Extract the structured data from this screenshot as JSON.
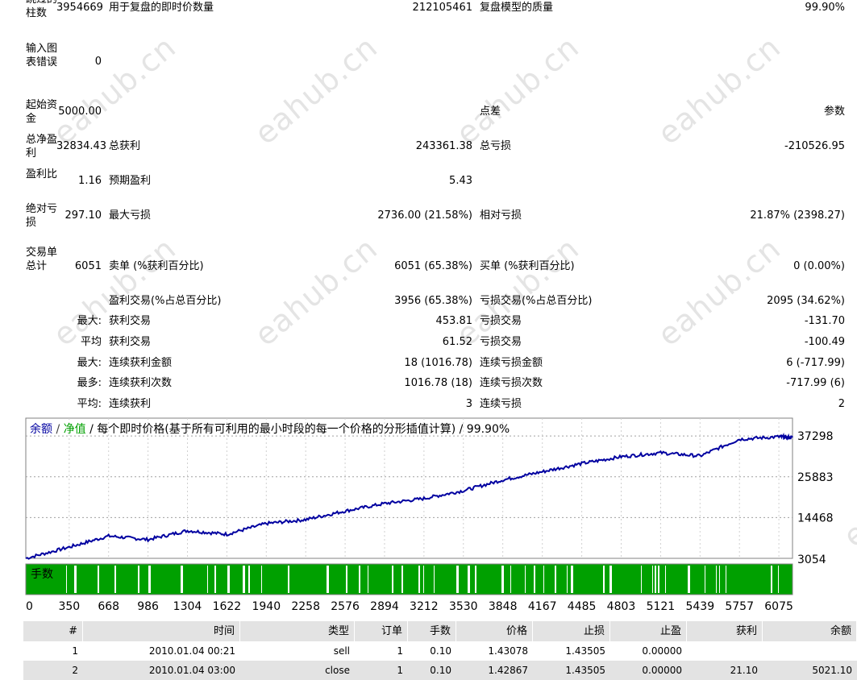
{
  "stats": {
    "r0": {
      "label": "跳过的柱数",
      "value": "3954669",
      "c2": "用于复盘的即时价数量",
      "v2": "212105461",
      "c3": "复盘模型的质量",
      "v3": "99.90%"
    },
    "r1": {
      "label": "输入图表错误",
      "value": "0"
    },
    "r2": {
      "label": "起始资金",
      "value": "5000.00",
      "c3": "点差",
      "v3": "参数"
    },
    "r3": {
      "label": "总净盈利",
      "value": "32834.43",
      "c2": "总获利",
      "v2": "243361.38",
      "c3": "总亏损",
      "v3": "-210526.95"
    },
    "r4": {
      "label": "盈利比",
      "value": "1.16",
      "c2": "预期盈利",
      "v2": "5.43"
    },
    "r5": {
      "label": "绝对亏损",
      "value": "297.10",
      "c2": "最大亏损",
      "v2": "2736.00 (21.58%)",
      "c3": "相对亏损",
      "v3": "21.87% (2398.27)"
    },
    "r6": {
      "label": "交易单总计",
      "value": "6051",
      "c2": "卖单 (%获利百分比)",
      "v2": "6051 (65.38%)",
      "c3": "买单 (%获利百分比)",
      "v3": "0 (0.00%)"
    },
    "r7": {
      "c2": "盈利交易(%占总百分比)",
      "v2": "3956 (65.38%)",
      "c3": "亏损交易(%占总百分比)",
      "v3": "2095 (34.62%)"
    },
    "r8": {
      "pre": "最大:",
      "c2": "获利交易",
      "v2": "453.81",
      "c3": "亏损交易",
      "v3": "-131.70"
    },
    "r9": {
      "pre": "平均",
      "c2": "获利交易",
      "v2": "61.52",
      "c3": "亏损交易",
      "v3": "-100.49"
    },
    "r10": {
      "pre": "最大:",
      "c2": "连续获利金额",
      "v2": "18 (1016.78)",
      "c3": "连续亏损金额",
      "v3": "6 (-717.99)"
    },
    "r11": {
      "pre": "最多:",
      "c2": "连续获利次数",
      "v2": "1016.78 (18)",
      "c3": "连续亏损次数",
      "v3": "-717.99 (6)"
    },
    "r12": {
      "pre": "平均:",
      "c2": "连续获利",
      "v2": "3",
      "c3": "连续亏损",
      "v3": "2"
    }
  },
  "watermark": "eahub.cn",
  "chart": {
    "legend_balance": "余额",
    "legend_sep": " / ",
    "legend_equity": "净值",
    "legend_rest": " / 每个即时价格(基于所有可利用的最小时段的每一个价格的分形插值计算) / 99.90%",
    "lots_label": "手数",
    "colors": {
      "balance": "#0000a0",
      "equity": "#00a000",
      "lots_bar": "#00a000",
      "grid": "#a0a0a0"
    }
  },
  "chart_data": {
    "type": "line",
    "series": [
      {
        "name": "余额",
        "x": [
          0,
          350,
          668,
          986,
          1304,
          1622,
          1940,
          2258,
          2576,
          2894,
          3212,
          3530,
          3848,
          4167,
          4485,
          4803,
          5121,
          5439,
          5757,
          6075,
          6185
        ],
        "y": [
          3054,
          6200,
          9300,
          8300,
          10800,
          9800,
          12800,
          13900,
          16300,
          18400,
          19800,
          22000,
          25000,
          27300,
          29600,
          31500,
          32600,
          31700,
          36400,
          37100,
          36900
        ]
      }
    ],
    "xlim": [
      0,
      6185
    ],
    "ylim": [
      3054,
      42300
    ],
    "y_ticks": [
      "37298",
      "25883",
      "14468",
      "3054"
    ],
    "x_ticks": [
      "0",
      "350",
      "668",
      "986",
      "1304",
      "1622",
      "1940",
      "2258",
      "2576",
      "2894",
      "3212",
      "3530",
      "3848",
      "4167",
      "4485",
      "4803",
      "5121",
      "5439",
      "5757",
      "6075"
    ],
    "grid": true
  },
  "table": {
    "headers": [
      "#",
      "时间",
      "类型",
      "订单",
      "手数",
      "价格",
      "止损",
      "止盈",
      "获利",
      "余额"
    ],
    "rows": [
      [
        "1",
        "2010.01.04 00:21",
        "sell",
        "1",
        "0.10",
        "1.43078",
        "1.43505",
        "0.00000",
        "",
        ""
      ],
      [
        "2",
        "2010.01.04 03:00",
        "close",
        "1",
        "0.10",
        "1.42867",
        "1.43505",
        "0.00000",
        "21.10",
        "5021.10"
      ]
    ]
  }
}
